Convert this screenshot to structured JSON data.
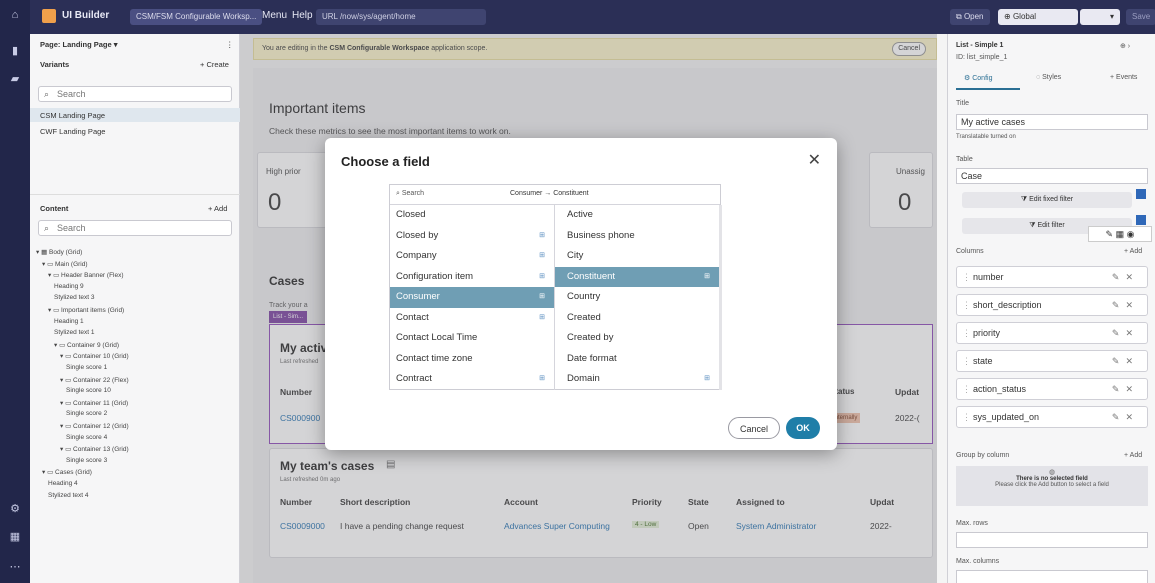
{
  "topbar": {
    "app_name": "UI Builder",
    "app_chip": "CSM/FSM Configurable Worksp...",
    "menu": "Menu",
    "help": "Help",
    "url_label": "URL",
    "url": "/now/sys/agent/home",
    "open_label": "Open",
    "scope": "Global",
    "save_label": "Save"
  },
  "left_panel": {
    "page_label": "Page: Landing Page ▾",
    "variants_label": "Variants",
    "create_label": "+ Create",
    "search_placeholder": "Search",
    "variants": [
      "CSM Landing Page",
      "CWF Landing Page"
    ],
    "content_label": "Content",
    "add_label": "+ Add",
    "content_search_placeholder": "Search",
    "tree": [
      "▾ ▦ Body (Grid)",
      "▾ ▭ Main (Grid)",
      "▾ ▭ Header Banner (Flex)",
      "Heading 9",
      "Stylized text 3",
      "▾ ▭ Important items (Grid)",
      "Heading 1",
      "Stylized text 1",
      "▾ ▭ Container 9 (Grid)",
      "▾ ▭ Container 10 (Grid)",
      "Single score 1",
      "▾ ▭ Container 22 (Flex)",
      "Single score 10",
      "▾ ▭ Container 11 (Grid)",
      "Single score 2",
      "▾ ▭ Container 12 (Grid)",
      "Single score 4",
      "▾ ▭ Container 13 (Grid)",
      "Single score 3",
      "▾ ▭ Cases (Grid)",
      "Heading 4",
      "Stylized text 4"
    ]
  },
  "banner": {
    "text_before": "You are editing in the ",
    "scope_name": "CSM Configurable Workspace",
    "text_after": " application scope.",
    "cancel": "Cancel"
  },
  "canvas": {
    "important_title": "Important items",
    "important_sub": "Check these metrics to see the most important items to work on.",
    "card_label_left": "High prior",
    "card_value_left": "0",
    "card_label_right": "Unassig",
    "card_value_right": "0",
    "cases_title": "Cases",
    "cases_sub": "Track your a",
    "list_chip": "List - Sim...",
    "my_active": "My activ",
    "my_active_sub": "Last refreshed",
    "col_number": "Number",
    "row_number": "CS000900",
    "col_status": "Status",
    "col_updated": "Updat",
    "row_updated": "2022-(",
    "status_badge": "Internally",
    "team_title": "My team's cases",
    "team_sub": "Last refreshed 0m ago",
    "team_columns": [
      "Number",
      "Short description",
      "Account",
      "Priority",
      "State",
      "Assigned to",
      "Updat"
    ],
    "team_row": [
      "CS0009000",
      "I have a pending change request",
      "Advances Super Computing",
      "4 - Low",
      "Open",
      "System Administrator",
      "2022-"
    ]
  },
  "modal": {
    "title": "Choose a field",
    "search_placeholder": "Search",
    "breadcrumb_a": "Consumer",
    "breadcrumb_b": "Constituent",
    "left_fields": [
      {
        "label": "Closed",
        "ref": false,
        "selected": false
      },
      {
        "label": "Closed by",
        "ref": true,
        "selected": false
      },
      {
        "label": "Company",
        "ref": true,
        "selected": false
      },
      {
        "label": "Configuration item",
        "ref": true,
        "selected": false
      },
      {
        "label": "Consumer",
        "ref": true,
        "selected": true
      },
      {
        "label": "Contact",
        "ref": true,
        "selected": false
      },
      {
        "label": "Contact Local Time",
        "ref": false,
        "selected": false
      },
      {
        "label": "Contact time zone",
        "ref": false,
        "selected": false
      },
      {
        "label": "Contract",
        "ref": true,
        "selected": false
      }
    ],
    "right_fields": [
      {
        "label": "Active",
        "ref": false,
        "selected": false
      },
      {
        "label": "Business phone",
        "ref": false,
        "selected": false
      },
      {
        "label": "City",
        "ref": false,
        "selected": false
      },
      {
        "label": "Constituent",
        "ref": true,
        "selected": true
      },
      {
        "label": "Country",
        "ref": false,
        "selected": false
      },
      {
        "label": "Created",
        "ref": false,
        "selected": false
      },
      {
        "label": "Created by",
        "ref": false,
        "selected": false
      },
      {
        "label": "Date format",
        "ref": false,
        "selected": false
      },
      {
        "label": "Domain",
        "ref": true,
        "selected": false
      }
    ],
    "cancel_label": "Cancel",
    "ok_label": "OK"
  },
  "right_panel": {
    "component_name": "List - Simple 1",
    "component_id": "ID: list_simple_1",
    "tabs": [
      "Config",
      "Styles",
      "+ Events"
    ],
    "title_label": "Title",
    "title_value": "My active cases",
    "translatable": "Translatable turned on",
    "table_label": "Table",
    "table_value": "Case",
    "edit_fixed_filter": "Edit fixed filter",
    "edit_filter": "Edit filter",
    "columns_label": "Columns",
    "add_label": "+ Add",
    "columns": [
      "number",
      "short_description",
      "priority",
      "state",
      "action_status",
      "sys_updated_on"
    ],
    "group_by_label": "Group by column",
    "group_by_add": "+ Add",
    "empty_title": "There is no selected field",
    "empty_sub": "Please click the Add button to select a field",
    "max_rows_label": "Max. rows",
    "max_columns_label": "Max. columns"
  },
  "colors": {
    "rail": "#22264a",
    "topbar": "#2b2f56",
    "selected_field": "#6f9eb4",
    "ok_button": "#1f7ea8",
    "list_chip": "#7a3fa0"
  }
}
